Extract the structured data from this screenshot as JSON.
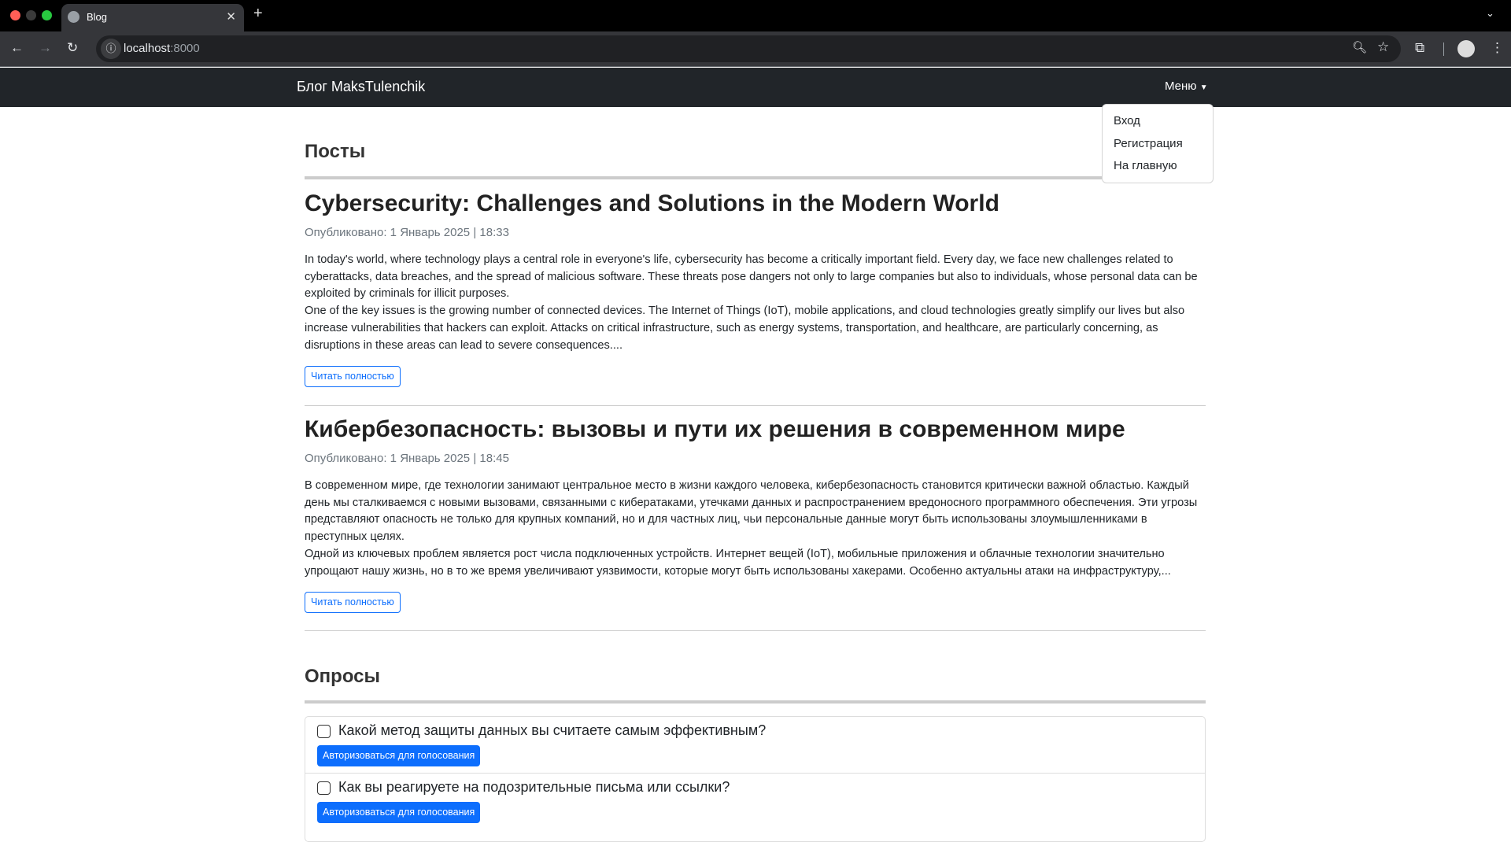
{
  "browser": {
    "tab_title": "Blog",
    "url_host": "localhost",
    "url_port": ":8000"
  },
  "navbar": {
    "brand": "Блог MaksTulenchik",
    "menu_label": "Меню",
    "menu_items": [
      "Вход",
      "Регистрация",
      "На главную"
    ]
  },
  "posts_section": {
    "heading": "Посты",
    "posts": [
      {
        "title": "Cybersecurity: Challenges and Solutions in the Modern World",
        "date": "Опубликовано: 1 Январь 2025 | 18:33",
        "paragraphs": [
          "In today's world, where technology plays a central role in everyone's life, cybersecurity has become a critically important field. Every day, we face new challenges related to cyberattacks, data breaches, and the spread of malicious software. These threats pose dangers not only to large companies but also to individuals, whose personal data can be exploited by criminals for illicit purposes.",
          "One of the key issues is the growing number of connected devices. The Internet of Things (IoT), mobile applications, and cloud technologies greatly simplify our lives but also increase vulnerabilities that hackers can exploit. Attacks on critical infrastructure, such as energy systems, transportation, and healthcare, are particularly concerning, as disruptions in these areas can lead to severe consequences...."
        ],
        "read_more": "Читать полностью"
      },
      {
        "title": "Кибербезопасность: вызовы и пути их решения в современном мире",
        "date": "Опубликовано: 1 Январь 2025 | 18:45",
        "paragraphs": [
          "В современном мире, где технологии занимают центральное место в жизни каждого человека, кибербезопасность становится критически важной областью. Каждый день мы сталкиваемся с новыми вызовами, связанными с кибератаками, утечками данных и распространением вредоносного программного обеспечения. Эти угрозы представляют опасность не только для крупных компаний, но и для частных лиц, чьи персональные данные могут быть использованы злоумышленниками в преступных целях.",
          "Одной из ключевых проблем является рост числа подключенных устройств. Интернет вещей (IoT), мобильные приложения и облачные технологии значительно упрощают нашу жизнь, но в то же время увеличивают уязвимости, которые могут быть использованы хакерами. Особенно актуальны атаки на инфраструктуру,..."
        ],
        "read_more": "Читать полностью"
      }
    ]
  },
  "polls_section": {
    "heading": "Опросы",
    "polls": [
      {
        "question": "Какой метод защиты данных вы считаете самым эффективным?",
        "button": "Авторизоваться для голосования",
        "checked": false
      },
      {
        "question": "Как вы реагируете на подозрительные письма или ссылки?",
        "button": "Авторизоваться для голосования",
        "checked": false
      }
    ]
  },
  "colors": {
    "navbar": "#212529",
    "primary": "#0d6efd"
  }
}
